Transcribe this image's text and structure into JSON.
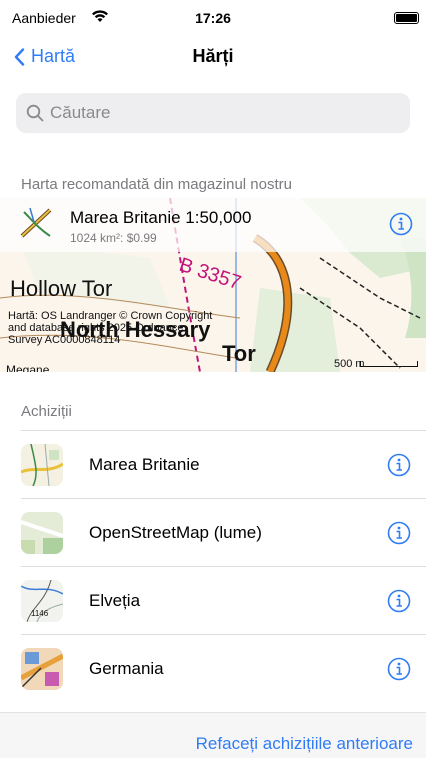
{
  "status_bar": {
    "carrier": "Aanbieder",
    "time": "17:26"
  },
  "nav": {
    "back_label": "Hartă",
    "title": "Hărți"
  },
  "search": {
    "placeholder": "Căutare"
  },
  "featured": {
    "header": "Harta recomandată din magazinul nostru",
    "title": "Marea Britanie 1:50,000",
    "subtitle": "1024 km²: $0.99",
    "map_labels": {
      "road": "B 3357",
      "place_left": "Hollow Tor",
      "place_mid": "North Hessary",
      "place_low": "Tor",
      "place_left_low": "Megane"
    },
    "attribution": "Hartă: OS Landranger © Crown Copyright and database rights 2025 Ordnance Survey AC0000848114",
    "scale": "500 m"
  },
  "purchases": {
    "header": "Achiziții",
    "items": [
      {
        "label": "Marea Britanie",
        "thumb": "os-map-thumb"
      },
      {
        "label": "OpenStreetMap (lume)",
        "thumb": "osm-map-thumb"
      },
      {
        "label": "Elveția",
        "thumb": "swiss-map-thumb",
        "thumb_text": "1146"
      },
      {
        "label": "Germania",
        "thumb": "germany-map-thumb"
      }
    ]
  },
  "bottom": {
    "restore_label": "Refaceți achizițiile anterioare"
  },
  "colors": {
    "accent": "#2f7cf6",
    "road": "#e88a1a",
    "road_label": "#c0147a"
  }
}
